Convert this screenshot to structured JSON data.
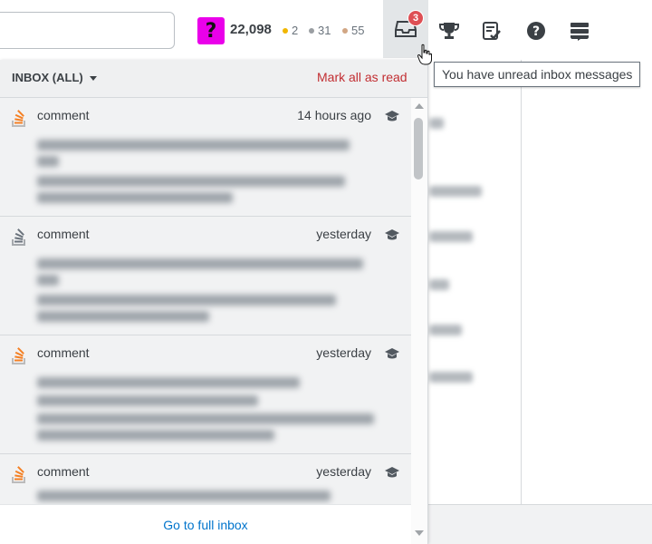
{
  "topbar": {
    "reputation": "22,098",
    "badges": {
      "gold": "2",
      "silver": "31",
      "bronze": "55",
      "gold_color": "#f1b600",
      "silver_color": "#9a9ea2",
      "bronze_color": "#d1a684"
    },
    "avatar_glyph": "?",
    "avatar_color": "#ea00ea",
    "inbox_unread_count": "3",
    "icons": [
      "inbox-icon",
      "trophy-icon",
      "review-icon",
      "help-icon",
      "site-switcher-icon"
    ],
    "tooltip": "You have unread inbox messages"
  },
  "inbox": {
    "title": "INBOX (ALL)",
    "mark_all_label": "Mark all as read",
    "footer_link": "Go to full inbox",
    "items": [
      {
        "type": "comment",
        "time": "14 hours ago",
        "icon": "stackoverflow-icon"
      },
      {
        "type": "comment",
        "time": "yesterday",
        "icon": "stackexchange-icon"
      },
      {
        "type": "comment",
        "time": "yesterday",
        "icon": "stackoverflow-icon"
      },
      {
        "type": "comment",
        "time": "yesterday",
        "icon": "stackoverflow-icon"
      }
    ]
  },
  "colors": {
    "accent_red": "#c22e32",
    "link_blue": "#0074cc",
    "unread_badge": "#de4f54"
  }
}
